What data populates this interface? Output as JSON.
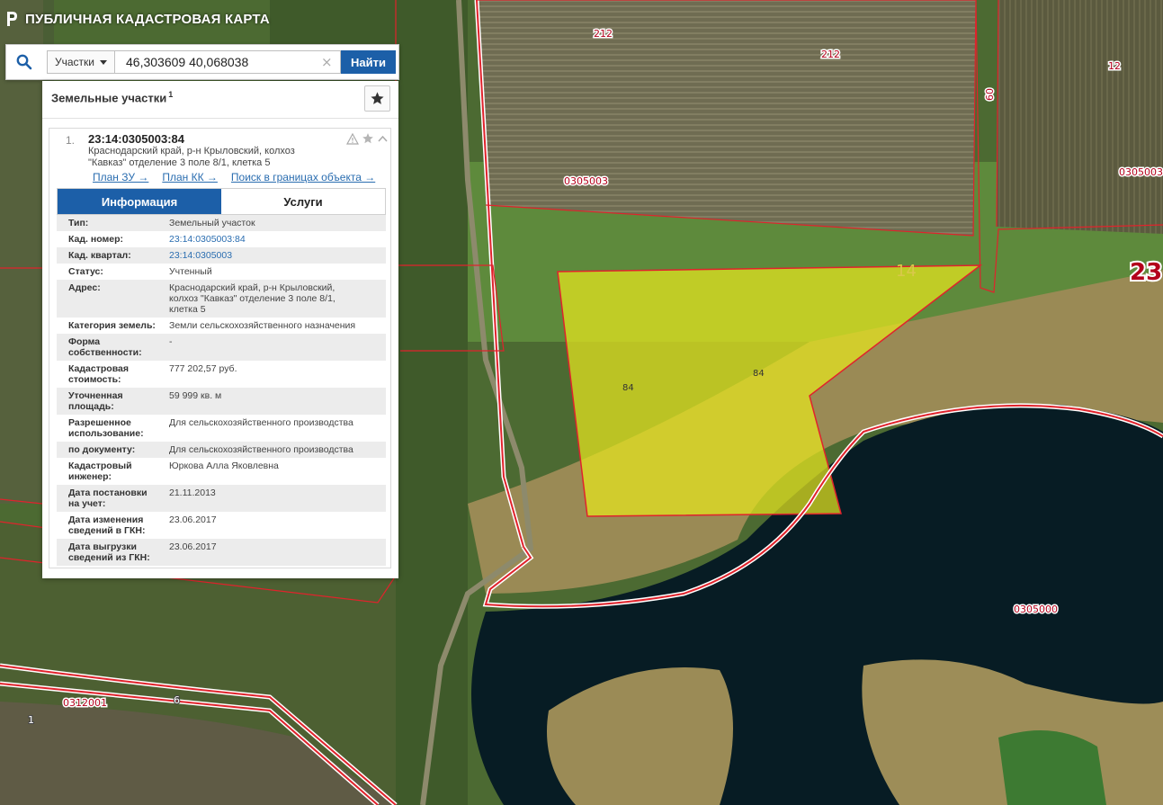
{
  "app": {
    "title": "ПУБЛИЧНАЯ КАДАСТРОВАЯ КАРТА"
  },
  "search": {
    "type_label": "Участки",
    "query": "46,303609 40,068038",
    "clear_symbol": "×",
    "find_label": "Найти"
  },
  "panel": {
    "title": "Земельные участки",
    "count": "1"
  },
  "result": {
    "index": "1.",
    "cad_number": "23:14:0305003:84",
    "address_lines": [
      "Краснодарский край, р-н Крыловский, колхоз",
      "\"Кавказ\" отделение 3 поле 8/1, клетка 5"
    ],
    "links": [
      "План ЗУ →",
      "План КК →",
      "Поиск в границах объекта →"
    ]
  },
  "tabs": [
    "Информация",
    "Услуги"
  ],
  "info_rows": [
    {
      "key": [
        "Тип:"
      ],
      "value": [
        "Земельный участок"
      ],
      "link": false
    },
    {
      "key": [
        "Кад. номер:"
      ],
      "value": [
        "23:14:0305003:84"
      ],
      "link": true
    },
    {
      "key": [
        "Кад. квартал:"
      ],
      "value": [
        "23:14:0305003"
      ],
      "link": true
    },
    {
      "key": [
        "Статус:"
      ],
      "value": [
        "Учтенный"
      ],
      "link": false
    },
    {
      "key": [
        "Адрес:"
      ],
      "value": [
        "Краснодарский край, р-н Крыловский,",
        "колхоз \"Кавказ\" отделение 3 поле 8/1,",
        "клетка 5"
      ],
      "link": false
    },
    {
      "key": [
        "Категория земель:"
      ],
      "value": [
        "Земли сельскохозяйственного назначения"
      ],
      "link": false
    },
    {
      "key": [
        "Форма",
        "собственности:"
      ],
      "value": [
        "-"
      ],
      "link": false
    },
    {
      "key": [
        "Кадастровая",
        "стоимость:"
      ],
      "value": [
        "777 202,57 руб."
      ],
      "link": false
    },
    {
      "key": [
        "Уточненная",
        "площадь:"
      ],
      "value": [
        "59 999 кв. м"
      ],
      "link": false
    },
    {
      "key": [
        "Разрешенное",
        "использование:"
      ],
      "value": [
        "Для сельскохозяйственного производства"
      ],
      "link": false
    },
    {
      "key": [
        "по документу:"
      ],
      "value": [
        "Для сельскохозяйственного производства"
      ],
      "link": false
    },
    {
      "key": [
        "Кадастровый",
        "инженер:"
      ],
      "value": [
        "Юркова Алла Яковлевна"
      ],
      "link": false
    },
    {
      "key": [
        "Дата постановки",
        "на учет:"
      ],
      "value": [
        "21.11.2013"
      ],
      "link": false
    },
    {
      "key": [
        "Дата изменения",
        "сведений в ГКН:"
      ],
      "value": [
        "23.06.2017"
      ],
      "link": false
    },
    {
      "key": [
        "Дата выгрузки",
        "сведений из ГКН:"
      ],
      "value": [
        "23.06.2017"
      ],
      "link": false
    }
  ],
  "map": {
    "labels": {
      "l212a": "212",
      "l212b": "212",
      "l12": "12",
      "l60": "60",
      "l0305003a": "0305003",
      "l0305003b": "0305003",
      "l23": "23",
      "l14": "14",
      "l84a": "84",
      "l84b": "84",
      "l0305000": "0305000",
      "l0312001": "0312001",
      "l6": "6",
      "l1": "1"
    },
    "colors": {
      "boundary": "#e0232c",
      "parcel_fill": "#e6e61e",
      "water": "#061a22",
      "field": "#6b6a4a"
    }
  }
}
